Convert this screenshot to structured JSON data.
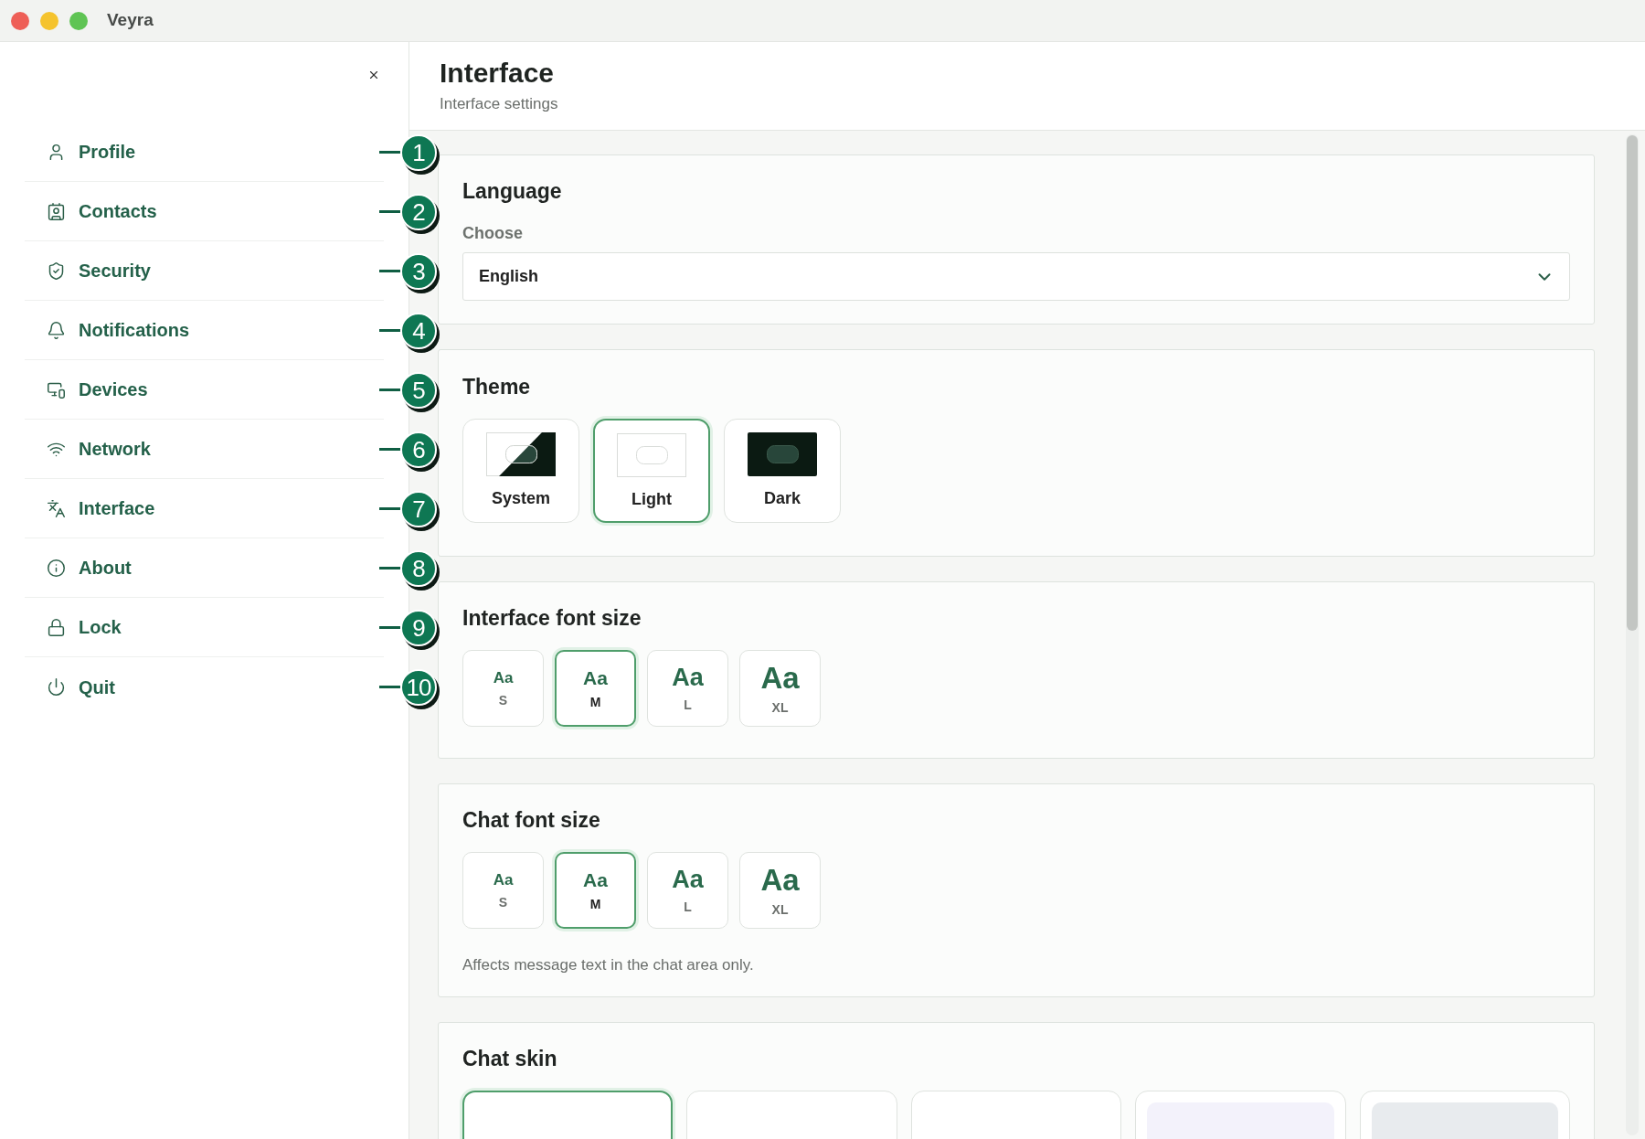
{
  "window": {
    "title": "Veyra"
  },
  "sidebar": {
    "items": [
      {
        "label": "Profile",
        "callout": "1"
      },
      {
        "label": "Contacts",
        "callout": "2"
      },
      {
        "label": "Security",
        "callout": "3"
      },
      {
        "label": "Notifications",
        "callout": "4"
      },
      {
        "label": "Devices",
        "callout": "5"
      },
      {
        "label": "Network",
        "callout": "6"
      },
      {
        "label": "Interface",
        "callout": "7"
      },
      {
        "label": "About",
        "callout": "8"
      },
      {
        "label": "Lock",
        "callout": "9"
      },
      {
        "label": "Quit",
        "callout": "10"
      }
    ]
  },
  "page": {
    "title": "Interface",
    "subtitle": "Interface settings"
  },
  "language": {
    "heading": "Language",
    "label": "Choose",
    "value": "English"
  },
  "theme": {
    "heading": "Theme",
    "options": [
      {
        "kind": "system",
        "label": "System",
        "selected": false
      },
      {
        "kind": "light",
        "label": "Light",
        "selected": true
      },
      {
        "kind": "dark",
        "label": "Dark",
        "selected": false
      }
    ]
  },
  "interface_font_size": {
    "heading": "Interface font size",
    "options": [
      {
        "sample": "Aa",
        "label": "S",
        "selected": false
      },
      {
        "sample": "Aa",
        "label": "M",
        "selected": true
      },
      {
        "sample": "Aa",
        "label": "L",
        "selected": false
      },
      {
        "sample": "Aa",
        "label": "XL",
        "selected": false
      }
    ]
  },
  "chat_font_size": {
    "heading": "Chat font size",
    "options": [
      {
        "sample": "Aa",
        "label": "S",
        "selected": false
      },
      {
        "sample": "Aa",
        "label": "M",
        "selected": true
      },
      {
        "sample": "Aa",
        "label": "L",
        "selected": false
      },
      {
        "sample": "Aa",
        "label": "XL",
        "selected": false
      }
    ],
    "note": "Affects message text in the chat area only."
  },
  "chat_skin": {
    "heading": "Chat skin",
    "options": [
      {
        "selected": true
      },
      {
        "selected": false
      },
      {
        "selected": false
      },
      {
        "selected": false,
        "color": "#f3f2fb"
      },
      {
        "selected": false,
        "color": "#e8ebee"
      }
    ]
  }
}
